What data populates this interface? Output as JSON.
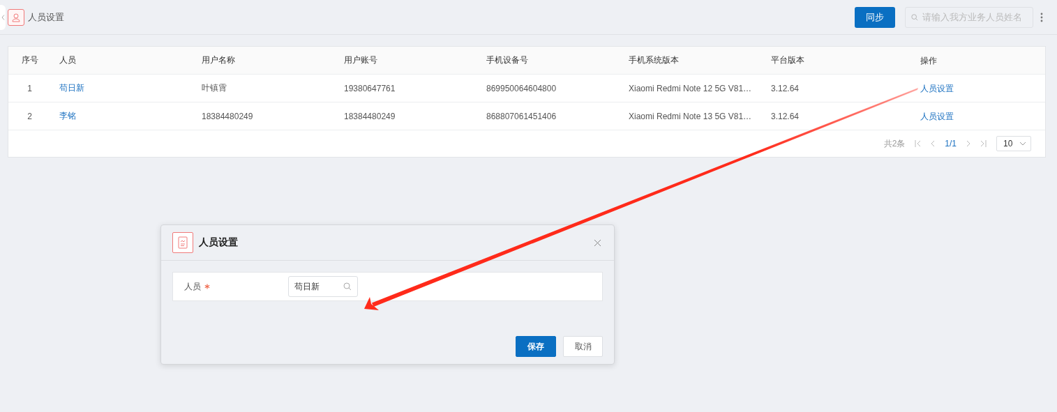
{
  "header": {
    "title": "人员设置",
    "sync_button": "同步",
    "search": {
      "placeholder": "请输入我方业务人员姓名"
    }
  },
  "table": {
    "columns": [
      "序号",
      "人员",
      "用户名称",
      "用户账号",
      "手机设备号",
      "手机系统版本",
      "平台版本",
      "操作"
    ],
    "rows": [
      {
        "index": "1",
        "person": "苟日新",
        "user_name": "叶镇霄",
        "account": "19380647761",
        "device": "869950064604800",
        "os": "Xiaomi Redmi Note 12 5G V81…",
        "platform": "3.12.64",
        "action": "人员设置"
      },
      {
        "index": "2",
        "person": "李铭",
        "user_name": "18384480249",
        "account": "18384480249",
        "device": "868807061451406",
        "os": "Xiaomi Redmi Note 13 5G V81…",
        "platform": "3.12.64",
        "action": "人员设置"
      }
    ]
  },
  "pagination": {
    "total": "共2条",
    "page": "1/1",
    "page_size": "10"
  },
  "dialog": {
    "title": "人员设置",
    "fields": [
      {
        "label": "人员",
        "required": true,
        "value": "苟日新"
      }
    ],
    "buttons": [
      {
        "label": "保存",
        "kind": "primary"
      },
      {
        "label": "取消",
        "kind": "secondary"
      }
    ]
  }
}
